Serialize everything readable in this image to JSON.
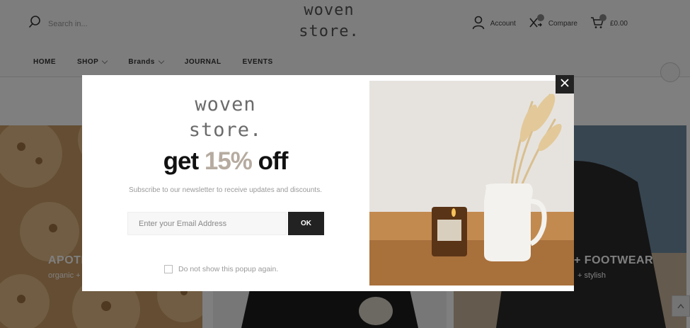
{
  "header": {
    "search_placeholder": "Search in...",
    "logo_line1": "woven",
    "logo_line2": "store.",
    "account_label": "Account",
    "compare_label": "Compare",
    "cart_total": "£0.00"
  },
  "nav": {
    "items": [
      {
        "label": "HOME",
        "has_dropdown": false
      },
      {
        "label": "SHOP",
        "has_dropdown": true
      },
      {
        "label": "Brands",
        "has_dropdown": true
      },
      {
        "label": "JOURNAL",
        "has_dropdown": false
      },
      {
        "label": "EVENTS",
        "has_dropdown": false
      }
    ]
  },
  "categories": [
    {
      "title": "APOTH",
      "subtitle": "organic +"
    },
    {
      "title": "",
      "subtitle": ""
    },
    {
      "title": "+ FOOTWEAR",
      "subtitle": "+ stylish"
    }
  ],
  "popup": {
    "logo_line1": "woven",
    "logo_line2": "store.",
    "headline_pre": "get ",
    "headline_pct": "15%",
    "headline_post": " off",
    "subtitle": "Subscribe to our newsletter to receive updates and discounts.",
    "email_placeholder": "Enter your Email Address",
    "email_value": "",
    "ok_label": "OK",
    "dont_show_label": "Do not show this popup again.",
    "dont_show_checked": false
  },
  "icons": {
    "search": "search-icon",
    "account": "user-icon",
    "compare": "compare-icon",
    "cart": "cart-icon",
    "close": "close-icon",
    "scroll_top": "chevron-up-icon"
  },
  "colors": {
    "overlay": "rgba(0,0,0,0.5)",
    "accent_pct": "#b6aba0",
    "button": "#222222"
  }
}
